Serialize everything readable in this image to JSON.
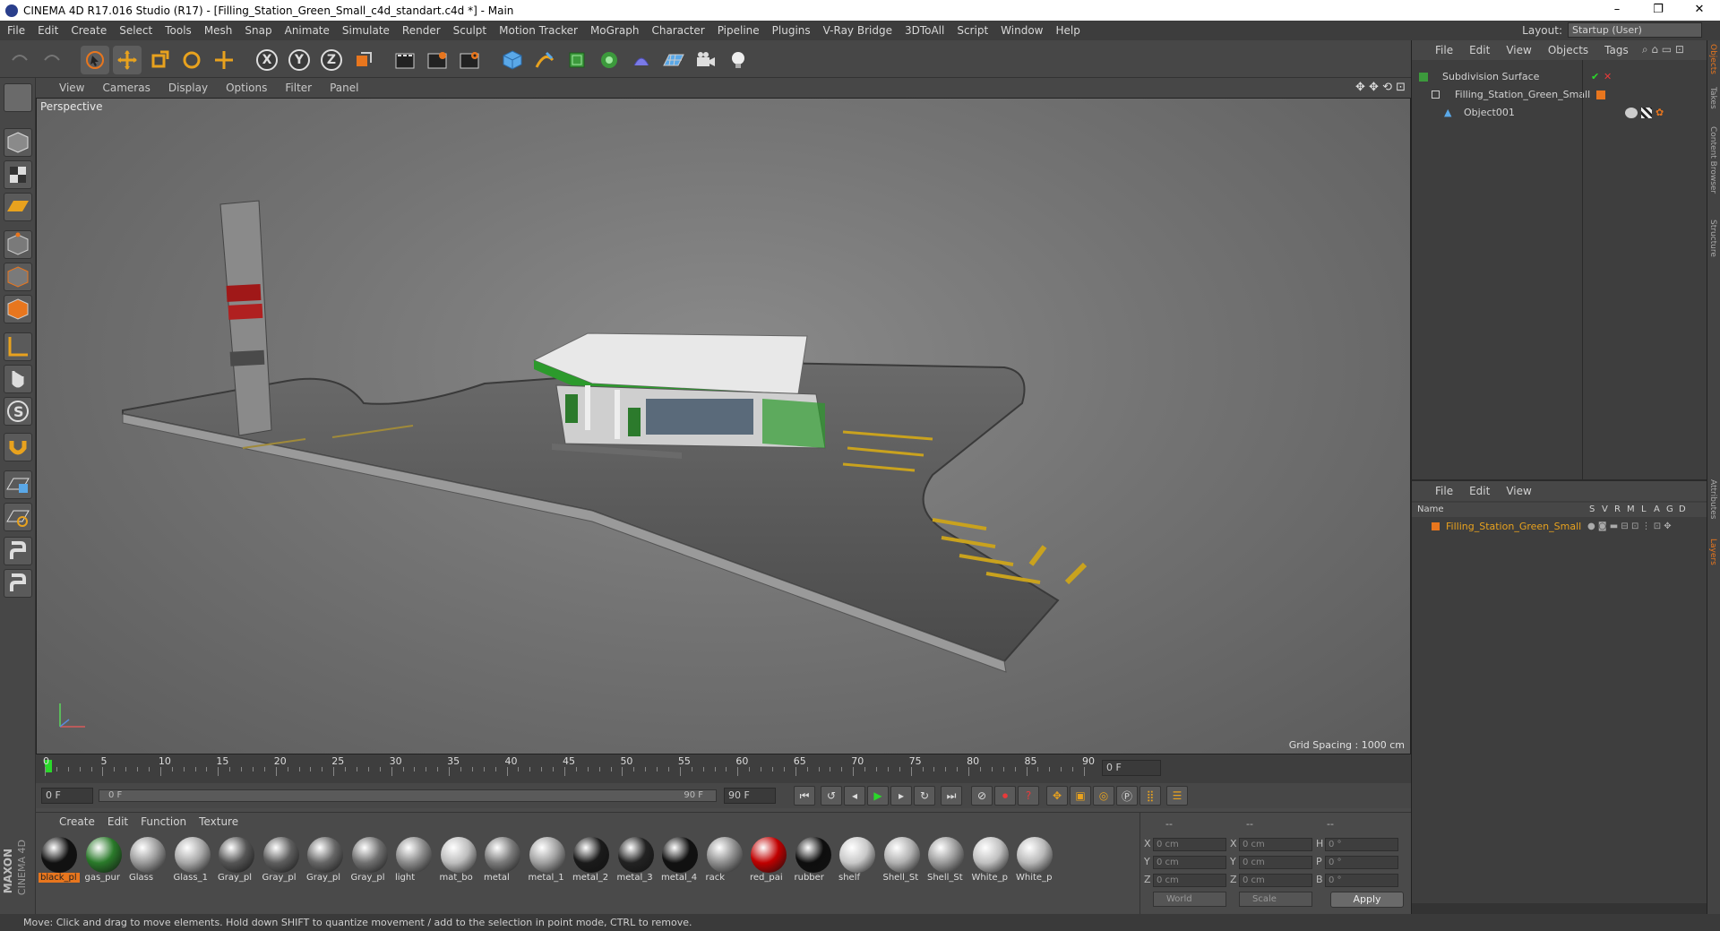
{
  "window": {
    "title": "CINEMA 4D R17.016 Studio (R17) - [Filling_Station_Green_Small_c4d_standart.c4d *] - Main",
    "buttons": [
      "–",
      "❐",
      "✕"
    ]
  },
  "menu": [
    "File",
    "Edit",
    "Create",
    "Select",
    "Tools",
    "Mesh",
    "Snap",
    "Animate",
    "Simulate",
    "Render",
    "Sculpt",
    "Motion Tracker",
    "MoGraph",
    "Character",
    "Pipeline",
    "Plugins",
    "V-Ray Bridge",
    "3DToAll",
    "Script",
    "Window",
    "Help"
  ],
  "layout": {
    "label": "Layout:",
    "value": "Startup (User)"
  },
  "toolbar": {
    "axes": [
      "X",
      "Y",
      "Z"
    ]
  },
  "viewport": {
    "menu": [
      "View",
      "Cameras",
      "Display",
      "Options",
      "Filter",
      "Panel"
    ],
    "label": "Perspective",
    "grid_spacing": "Grid Spacing : 1000 cm"
  },
  "timeline": {
    "ticks": [
      "0",
      "5",
      "10",
      "15",
      "20",
      "25",
      "30",
      "35",
      "40",
      "45",
      "50",
      "55",
      "60",
      "65",
      "70",
      "75",
      "80",
      "85",
      "90"
    ],
    "end_field": "0 F",
    "cur_frame": "0 F",
    "range_start": "0 F",
    "range_end": "90 F",
    "max_frame": "90 F"
  },
  "materials": {
    "menu": [
      "Create",
      "Edit",
      "Function",
      "Texture"
    ],
    "items": [
      {
        "label": "black_pl",
        "color": "#111111",
        "selected": true
      },
      {
        "label": "gas_pur",
        "color": "#2a7a2a"
      },
      {
        "label": "Glass",
        "color": "#9a9a9a"
      },
      {
        "label": "Glass_1",
        "color": "#a8a8a8"
      },
      {
        "label": "Gray_pl",
        "color": "#555555"
      },
      {
        "label": "Gray_pl",
        "color": "#5e5e5e"
      },
      {
        "label": "Gray_pl",
        "color": "#666666"
      },
      {
        "label": "Gray_pl",
        "color": "#707070"
      },
      {
        "label": "light",
        "color": "#8a8a8a"
      },
      {
        "label": "mat_bo",
        "color": "#bdbdbd"
      },
      {
        "label": "metal",
        "color": "#7a7a7a"
      },
      {
        "label": "metal_1",
        "color": "#a0a0a0"
      },
      {
        "label": "metal_2",
        "color": "#1a1a1a"
      },
      {
        "label": "metal_3",
        "color": "#222222"
      },
      {
        "label": "metal_4",
        "color": "#111111"
      },
      {
        "label": "rack",
        "color": "#8e8e8e"
      },
      {
        "label": "red_pai",
        "color": "#c00000"
      },
      {
        "label": "rubber",
        "color": "#0e0e0e"
      },
      {
        "label": "shelf",
        "color": "#c8c8c8"
      },
      {
        "label": "Shell_St",
        "color": "#b0b0b0"
      },
      {
        "label": "Shell_St",
        "color": "#9a9a9a"
      },
      {
        "label": "White_p",
        "color": "#c0c0c0"
      },
      {
        "label": "White_p",
        "color": "#b8b8b8"
      }
    ]
  },
  "coords": {
    "header": [
      "--",
      "--",
      "--"
    ],
    "rows": [
      {
        "a": "X",
        "av": "0 cm",
        "b": "X",
        "bv": "0 cm",
        "c": "H",
        "cv": "0 °"
      },
      {
        "a": "Y",
        "av": "0 cm",
        "b": "Y",
        "bv": "0 cm",
        "c": "P",
        "cv": "0 °"
      },
      {
        "a": "Z",
        "av": "0 cm",
        "b": "Z",
        "bv": "0 cm",
        "c": "B",
        "cv": "0 °"
      }
    ],
    "world": "World",
    "scale": "Scale",
    "apply": "Apply"
  },
  "objects": {
    "menu": [
      "File",
      "Edit",
      "View",
      "Objects",
      "Tags"
    ],
    "items": [
      {
        "name": "Subdivision Surface",
        "indent": 0
      },
      {
        "name": "Filling_Station_Green_Small",
        "indent": 1
      },
      {
        "name": "Object001",
        "indent": 2
      }
    ]
  },
  "layers": {
    "menu": [
      "File",
      "Edit",
      "View"
    ],
    "cols": [
      "Name",
      "S",
      "V",
      "R",
      "M",
      "L",
      "A",
      "G",
      "D"
    ],
    "item": "Filling_Station_Green_Small"
  },
  "side_tabs": [
    "Objects",
    "Takes",
    "Content Browser",
    "Structure",
    "Attributes",
    "Layers"
  ],
  "status": "Move: Click and drag to move elements. Hold down SHIFT to quantize movement / add to the selection in point mode, CTRL to remove.",
  "brand": [
    "MAXON",
    "CINEMA 4D"
  ]
}
